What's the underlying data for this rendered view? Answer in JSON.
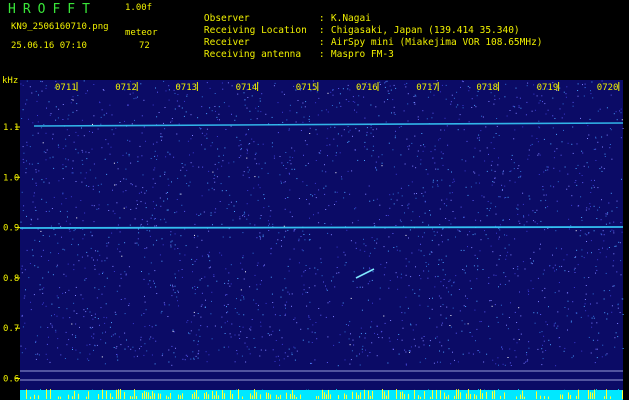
{
  "header": {
    "title": "HROFFT",
    "version": "1.00f",
    "filename": "KN9_2506160710.png",
    "datetime": "25.06.16 07:10",
    "meteor_label": "meteor",
    "meteor_count": "72"
  },
  "info": [
    {
      "label": "Observer",
      "value": "K.Nagai"
    },
    {
      "label": "Receiving Location",
      "value": "Chigasaki, Japan (139.414 35.340)"
    },
    {
      "label": "Receiver",
      "value": "AirSpy mini (Miakejima VOR 108.65MHz)"
    },
    {
      "label": "Receiving antenna",
      "value": "Maspro FM-3"
    }
  ],
  "axis": {
    "y_unit": "kHz",
    "y_ticks": [
      "1.1",
      "1.0",
      "0.9",
      "0.8",
      "0.7",
      "0.6"
    ],
    "x_ticks": [
      "0711",
      "0712",
      "0713",
      "0714",
      "0715",
      "0716",
      "0717",
      "0718",
      "0719",
      "0720"
    ]
  },
  "colors": {
    "background": "#000000",
    "label": "#f0f000",
    "title": "#39e639",
    "spectrogram_bg": "#0b0b66",
    "signal": "#38d2ff",
    "bottom_bar": "#00e8ff"
  }
}
